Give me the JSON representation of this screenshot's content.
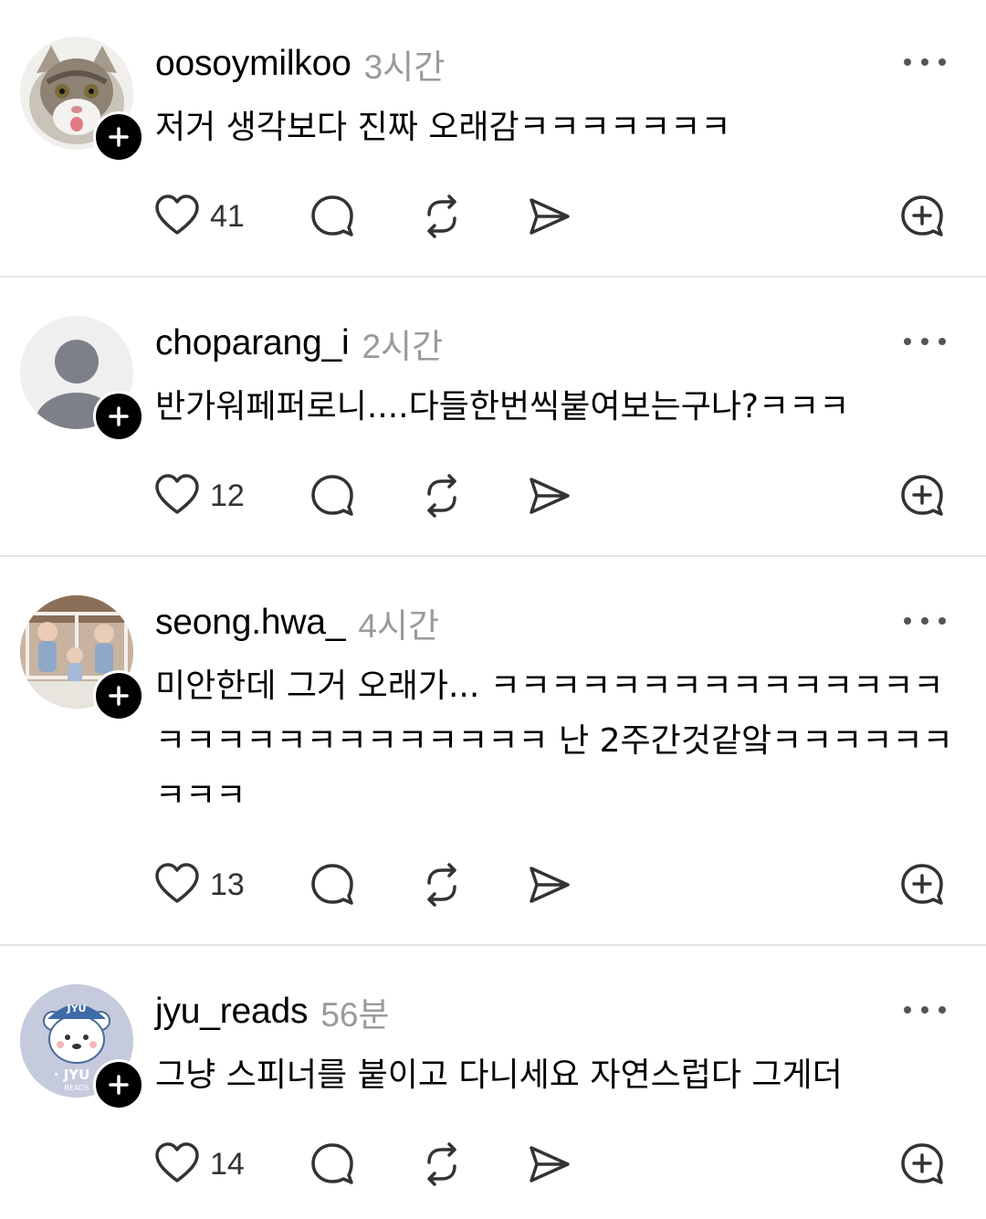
{
  "posts": [
    {
      "username": "oosoymilkoo",
      "time": "3시간",
      "text": "저거 생각보다 진짜 오래감ㅋㅋㅋㅋㅋㅋㅋ",
      "likes": "41",
      "avatar": "cat-photo"
    },
    {
      "username": "choparang_i",
      "time": "2시간",
      "text": "반가워페퍼로니....다들한번씩붙여보는구나?ㅋㅋㅋ",
      "likes": "12",
      "avatar": "default-person"
    },
    {
      "username": "seong.hwa_",
      "time": "4시간",
      "text": "미안한데 그거 오래가... ㅋㅋㅋㅋㅋㅋㅋㅋㅋㅋㅋㅋㅋㅋㅋㅋㅋㅋㅋㅋㅋㅋㅋㅋㅋㅋㅋㅋ 난 2주간것같앜ㅋㅋㅋㅋㅋㅋㅋㅋㅋ",
      "likes": "13",
      "avatar": "children-photo"
    },
    {
      "username": "jyu_reads",
      "time": "56분",
      "text": "그냥 스피너를 붙이고 다니세요 자연스럽다 그게더",
      "likes": "14",
      "avatar": "bear-logo",
      "avatar_text_top": "JYU",
      "avatar_text_mid": "· JYU ·",
      "avatar_text_bottom": "READS"
    }
  ],
  "colors": {
    "divider": "#e4e4e4",
    "meta": "#9a9a9a",
    "icon": "#333333"
  }
}
